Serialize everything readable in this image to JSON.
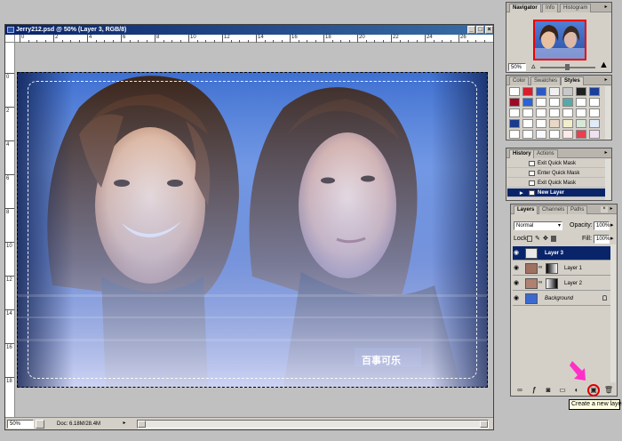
{
  "document": {
    "title": "Jerry212.psd @ 50% (Layer 3, RGB/8)",
    "zoom": "50%",
    "doc_size": "Doc: 6.18M/28.4M",
    "ruler_top_labels": [
      "0",
      "2",
      "4",
      "6",
      "8",
      "10",
      "12",
      "14",
      "16",
      "18",
      "20",
      "22",
      "24",
      "26",
      "28"
    ],
    "ruler_left_labels": [
      "0",
      "2",
      "4",
      "6",
      "8",
      "10",
      "12",
      "14",
      "16",
      "18"
    ],
    "image_watermark": "百事可乐",
    "window_buttons": {
      "minimize": "_",
      "maximize": "□",
      "close": "×"
    }
  },
  "navigator": {
    "tabs": [
      "Navigator",
      "Info",
      "Histogram"
    ],
    "zoom": "50%"
  },
  "styles": {
    "tabs": [
      "Color",
      "Swatches",
      "Styles"
    ],
    "swatch_colors": [
      [
        "#ffffff",
        "#d81e2c",
        "#2b59c3",
        "#f0f0f0",
        "#c8c8c8",
        "#202020",
        "#1a3e9a"
      ],
      [
        "#9b0a24",
        "#2a63d6",
        "#ffffff",
        "#ffffff",
        "#58a8a8",
        "#ffffff",
        "#ffffff"
      ],
      [
        "#ffffff",
        "#ffffff",
        "#ffffff",
        "#ffffff",
        "#ffffff",
        "#ffffff",
        "#ffffff"
      ],
      [
        "#1a3a8c",
        "#ffffff",
        "#ffffff",
        "#e8d8c8",
        "#f2eecc",
        "#d8e8d8",
        "#e0ecf8"
      ],
      [
        "#ffffff",
        "#ffffff",
        "#f8f8ff",
        "#ffffff",
        "#ffe8e8",
        "#e84050",
        "#f0e0f0"
      ]
    ]
  },
  "history": {
    "tabs": [
      "History",
      "Actions"
    ],
    "items": [
      "Exit Quick Mask",
      "Enter Quick Mask",
      "Exit Quick Mask",
      "New Layer"
    ],
    "active_index": 3
  },
  "layers": {
    "tabs": [
      "Layers",
      "Channels",
      "Paths"
    ],
    "blend_mode": "Normal",
    "opacity_label": "Opacity:",
    "opacity": "100%",
    "lock_label": "Lock:",
    "fill_label": "Fill:",
    "fill": "100%",
    "rows": [
      {
        "name": "Layer 3",
        "active": true
      },
      {
        "name": "Layer 1",
        "active": false
      },
      {
        "name": "Layer 2",
        "active": false
      },
      {
        "name": "Background",
        "active": false
      }
    ],
    "bottom_buttons": [
      "link-layers",
      "add-layer-style",
      "add-layer-mask",
      "create-new-set",
      "create-adjustment-layer",
      "create-new-layer",
      "delete-layer"
    ]
  },
  "tooltip": {
    "text": "Create a new layer"
  },
  "colors": {
    "titlebar": "#0a246a",
    "highlight": "#0a246a",
    "arrow": "#ff2fc8",
    "circle": "#e00000"
  }
}
